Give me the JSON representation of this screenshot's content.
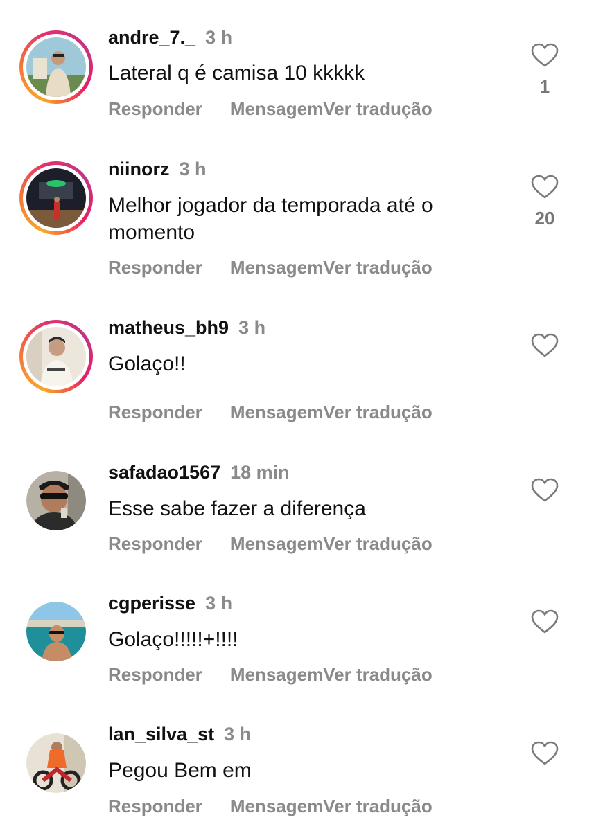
{
  "comments": [
    {
      "username": "andre_7._",
      "time": "3 h",
      "text": "Lateral q é camisa 10 kkkkk",
      "reply_label": "Responder",
      "message_label": "Mensagem",
      "translate_label": "Ver tradução",
      "likes": "1"
    },
    {
      "username": "niinorz",
      "time": "3 h",
      "text": "Melhor jogador da temporada até o momento",
      "reply_label": "Responder",
      "message_label": "Mensagem",
      "translate_label": "Ver tradução",
      "likes": "20"
    },
    {
      "username": "matheus_bh9",
      "time": "3 h",
      "text": "Golaço!!",
      "reply_label": "Responder",
      "message_label": "Mensagem",
      "translate_label": "Ver tradução",
      "likes": ""
    },
    {
      "username": "safadao1567",
      "time": "18 min",
      "text": "Esse sabe fazer a diferença",
      "reply_label": "Responder",
      "message_label": "Mensagem",
      "translate_label": "Ver tradução",
      "likes": ""
    },
    {
      "username": "cgperisse",
      "time": "3 h",
      "text": "Golaço!!!!!+!!!!",
      "reply_label": "Responder",
      "message_label": "Mensagem",
      "translate_label": "Ver tradução",
      "likes": ""
    },
    {
      "username": "lan_silva_st",
      "time": "3 h",
      "text": "Pegou Bem em",
      "reply_label": "Responder",
      "message_label": "Mensagem",
      "translate_label": "Ver tradução",
      "likes": ""
    }
  ],
  "icons": {
    "like": "heart-outline-icon",
    "story_ring": "story-ring-gradient"
  },
  "colors": {
    "secondary_text": "#8a8a8a",
    "primary_text": "#111111",
    "story_ring_start": "#f9a825",
    "story_ring_end": "#c13584"
  }
}
